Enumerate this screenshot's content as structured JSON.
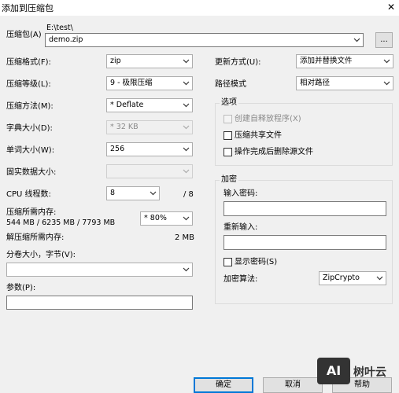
{
  "window": {
    "title": "添加到压缩包",
    "close_glyph": "✕"
  },
  "archive": {
    "label": "压缩包(A)",
    "path": "E:\\test\\",
    "filename": "demo.zip",
    "browse_label": "..."
  },
  "left": {
    "format": {
      "label": "压缩格式(F):",
      "value": "zip"
    },
    "level": {
      "label": "压缩等级(L):",
      "value": "9 - 极限压缩"
    },
    "method": {
      "label": "压缩方法(M):",
      "value": "* Deflate"
    },
    "dict": {
      "label": "字典大小(D):",
      "value": "* 32 KB"
    },
    "word": {
      "label": "单词大小(W):",
      "value": "256"
    },
    "solid": {
      "label": "固实数据大小:",
      "value": ""
    },
    "threads": {
      "label": "CPU 线程数:",
      "value": "8",
      "max": "/ 8"
    },
    "memory": {
      "label": "压缩所需内存:",
      "detail": "544 MB / 6235 MB / 7793 MB",
      "value": "* 80%"
    },
    "decomp": {
      "label": "解压缩所需内存:",
      "value": "2 MB"
    },
    "split": {
      "label": "分卷大小，字节(V):",
      "value": ""
    },
    "params": {
      "label": "参数(P):",
      "value": ""
    }
  },
  "right": {
    "update": {
      "label": "更新方式(U):",
      "value": "添加并替换文件"
    },
    "pathmode": {
      "label": "路径模式",
      "value": "相对路径"
    },
    "options": {
      "title": "选项",
      "sfx": "创建自释放程序(X)",
      "shared": "压缩共享文件",
      "delete": "操作完成后删除源文件"
    },
    "encrypt": {
      "title": "加密",
      "password_label": "输入密码:",
      "password": "",
      "reenter_label": "重新输入:",
      "reenter": "",
      "show_label": "显示密码(S)",
      "method_label": "加密算法:",
      "method_value": "ZipCrypto"
    }
  },
  "footer": {
    "ok": "确定",
    "cancel": "取消",
    "help": "帮助"
  },
  "watermark": {
    "logo": "AI",
    "text": "树叶云"
  }
}
